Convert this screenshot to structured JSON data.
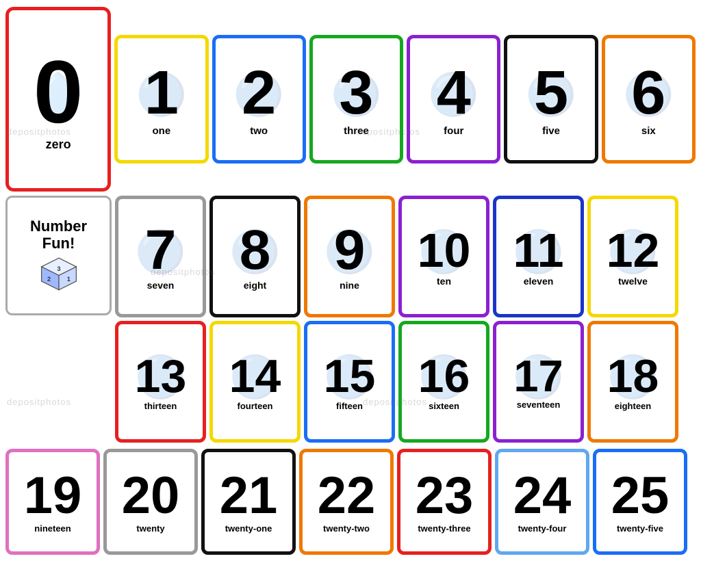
{
  "cards": [
    {
      "num": "0",
      "word": "zero",
      "border": "red",
      "row": 0
    },
    {
      "num": "1",
      "word": "one",
      "border": "yellow",
      "row": 1
    },
    {
      "num": "2",
      "word": "two",
      "border": "blue",
      "row": 1
    },
    {
      "num": "3",
      "word": "three",
      "border": "green",
      "row": 1
    },
    {
      "num": "4",
      "word": "four",
      "border": "purple",
      "row": 1
    },
    {
      "num": "5",
      "word": "five",
      "border": "black",
      "row": 1
    },
    {
      "num": "6",
      "word": "six",
      "border": "orange",
      "row": 1
    },
    {
      "num": "7",
      "word": "seven",
      "border": "gray",
      "row": 2
    },
    {
      "num": "8",
      "word": "eight",
      "border": "black",
      "row": 2
    },
    {
      "num": "9",
      "word": "nine",
      "border": "orange",
      "row": 2
    },
    {
      "num": "10",
      "word": "ten",
      "border": "purple",
      "row": 2
    },
    {
      "num": "11",
      "word": "eleven",
      "border": "darkblue",
      "row": 2
    },
    {
      "num": "12",
      "word": "twelve",
      "border": "yellow",
      "row": 2
    },
    {
      "num": "13",
      "word": "thirteen",
      "border": "red",
      "row": 3
    },
    {
      "num": "14",
      "word": "fourteen",
      "border": "yellow",
      "row": 3
    },
    {
      "num": "15",
      "word": "fifteen",
      "border": "blue",
      "row": 3
    },
    {
      "num": "16",
      "word": "sixteen",
      "border": "green",
      "row": 3
    },
    {
      "num": "17",
      "word": "seventeen",
      "border": "purple",
      "row": 3
    },
    {
      "num": "18",
      "word": "eighteen",
      "border": "orange",
      "row": 3
    },
    {
      "num": "19",
      "word": "nineteen",
      "border": "pink",
      "row": 4
    },
    {
      "num": "20",
      "word": "twenty",
      "border": "gray",
      "row": 4
    },
    {
      "num": "21",
      "word": "twenty-one",
      "border": "black",
      "row": 4
    },
    {
      "num": "22",
      "word": "twenty-two",
      "border": "orange",
      "row": 4
    },
    {
      "num": "23",
      "word": "twenty-three",
      "border": "red",
      "row": 4
    },
    {
      "num": "24",
      "word": "twenty-four",
      "border": "lightblue",
      "row": 4
    },
    {
      "num": "25",
      "word": "twenty-five",
      "border": "blue",
      "row": 4
    }
  ],
  "numfun": {
    "line1": "Number",
    "line2": "Fun!"
  },
  "watermarks": [
    "depositphotos",
    "depositphotos",
    "depositphotos",
    "depositphotos"
  ]
}
